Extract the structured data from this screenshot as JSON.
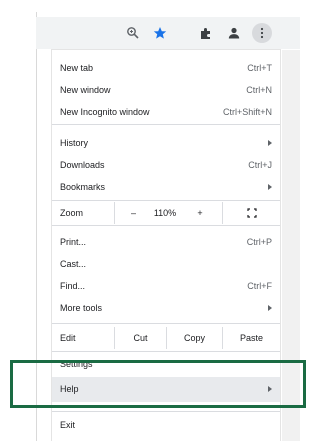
{
  "toolbar": {
    "icons": [
      "zoom-icon",
      "star-icon",
      "extensions-icon",
      "profile-icon",
      "menu-dots-icon"
    ]
  },
  "menu": {
    "groups": [
      {
        "items": [
          {
            "label": "New tab",
            "shortcut": "Ctrl+T"
          },
          {
            "label": "New window",
            "shortcut": "Ctrl+N"
          },
          {
            "label": "New Incognito window",
            "shortcut": "Ctrl+Shift+N"
          }
        ]
      },
      {
        "items": [
          {
            "label": "History",
            "submenu": true
          },
          {
            "label": "Downloads",
            "shortcut": "Ctrl+J"
          },
          {
            "label": "Bookmarks",
            "submenu": true
          }
        ]
      },
      {
        "zoom": {
          "label": "Zoom",
          "minus": "–",
          "value": "110%",
          "plus": "+"
        }
      },
      {
        "items": [
          {
            "label": "Print...",
            "shortcut": "Ctrl+P"
          },
          {
            "label": "Cast..."
          },
          {
            "label": "Find...",
            "shortcut": "Ctrl+F"
          },
          {
            "label": "More tools",
            "submenu": true
          }
        ]
      },
      {
        "edit": {
          "label": "Edit",
          "cut": "Cut",
          "copy": "Copy",
          "paste": "Paste"
        }
      },
      {
        "items": [
          {
            "label": "Settings"
          },
          {
            "label": "Help",
            "submenu": true
          }
        ]
      },
      {
        "items": [
          {
            "label": "Exit"
          }
        ]
      }
    ]
  },
  "colors": {
    "highlight": "#1a6b43",
    "star": "#1a73e8"
  }
}
